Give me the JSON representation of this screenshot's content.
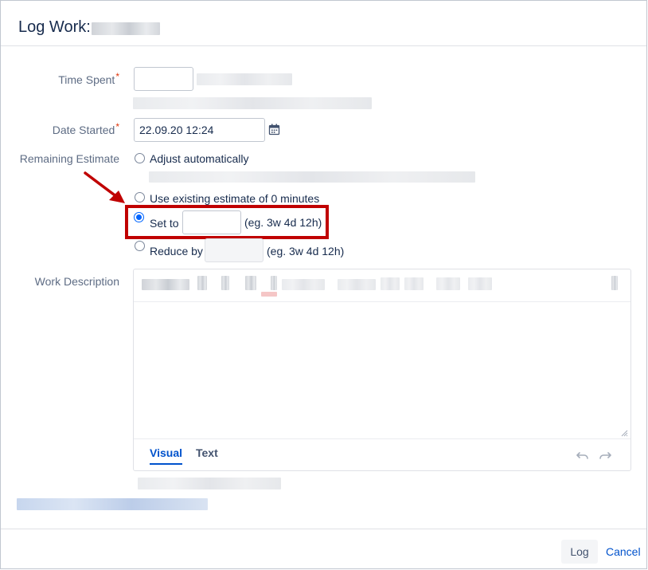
{
  "dialog": {
    "title": "Log Work:"
  },
  "form": {
    "time_spent": {
      "label": "Time Spent",
      "required_mark": "*",
      "value": ""
    },
    "date_started": {
      "label": "Date Started",
      "required_mark": "*",
      "value": "22.09.20 12:24"
    },
    "remaining_estimate": {
      "label": "Remaining Estimate",
      "options": {
        "adjust": "Adjust automatically",
        "existing": "Use existing estimate of 0 minutes",
        "set_to": "Set to",
        "reduce_by": "Reduce by"
      },
      "selected": "set_to",
      "set_to_value": "",
      "set_to_hint": "(eg. 3w 4d 12h)",
      "reduce_by_value": "",
      "reduce_by_hint": "(eg. 3w 4d 12h)"
    },
    "work_description": {
      "label": "Work Description",
      "value": "",
      "tabs": {
        "visual": "Visual",
        "text": "Text"
      },
      "active_tab": "visual"
    }
  },
  "icons": {
    "calendar": "calendar-icon",
    "undo": "undo-icon",
    "redo": "redo-icon",
    "arrow": "annotation-arrow-icon"
  },
  "footer": {
    "log_label": "Log",
    "cancel_label": "Cancel"
  },
  "colors": {
    "accent": "#0052cc",
    "radio_selected": "#0065ff",
    "required": "#de350b",
    "highlight": "#c00000"
  }
}
